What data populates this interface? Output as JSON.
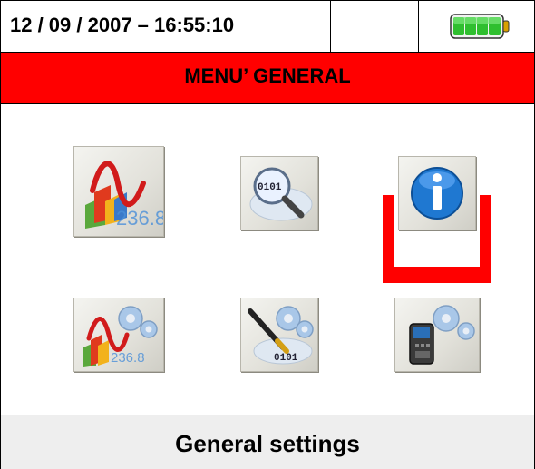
{
  "status_bar": {
    "datetime": "12 / 09 / 2007 – 16:55:10",
    "battery_icon": "battery-full-icon"
  },
  "title_bar": {
    "title": "MENU’ GENERAL"
  },
  "menu": {
    "items": [
      {
        "icon": "measurement-chart-icon",
        "label": "236.8"
      },
      {
        "icon": "data-search-icon",
        "label": "0101"
      },
      {
        "icon": "info-icon"
      },
      {
        "icon": "measurement-settings-icon",
        "label": "236.8"
      },
      {
        "icon": "data-settings-icon",
        "label": "0101"
      },
      {
        "icon": "general-settings-icon",
        "selected": true
      }
    ]
  },
  "footer": {
    "label": "General settings"
  },
  "colors": {
    "title_bar": "#ff0000",
    "selection": "#ff0000",
    "battery": "#33cc33"
  }
}
